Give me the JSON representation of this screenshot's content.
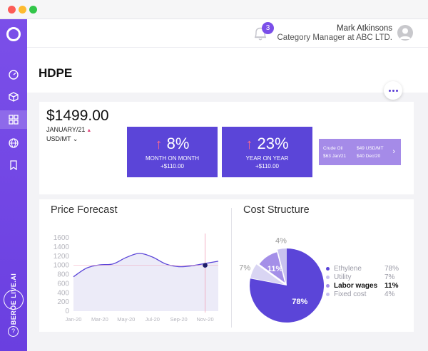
{
  "window": {
    "controls": [
      "close",
      "minimize",
      "maximize"
    ]
  },
  "sidebar": {
    "items": [
      {
        "name": "dashboard",
        "icon": "speedometer-icon",
        "active": false
      },
      {
        "name": "products",
        "icon": "cube-icon",
        "active": false
      },
      {
        "name": "grid",
        "icon": "grid-icon",
        "active": true
      },
      {
        "name": "global",
        "icon": "globe-icon",
        "active": false
      },
      {
        "name": "bookmarks",
        "icon": "bookmark-icon",
        "active": false
      }
    ],
    "brand": "BERÖE LIVE.AI",
    "help": "?"
  },
  "header": {
    "notifications_count": "3",
    "user_name": "Mark Atkinsons",
    "user_role": "Category Manager at ABC LTD."
  },
  "page": {
    "title": "HDPE"
  },
  "price": {
    "value": "$1499.00",
    "date": "JANUARY/21",
    "unit": "USD/MT",
    "unit_chevron": "⌄"
  },
  "kpis": {
    "mom": {
      "pct": "8%",
      "label": "MONTH ON MONTH",
      "delta": "+$110.00"
    },
    "yoy": {
      "pct": "23%",
      "label": "YEAR ON YEAR",
      "delta": "+$110.00"
    }
  },
  "crude_oil": {
    "name": "Crude Oil",
    "current": "$49 USD/MT",
    "low": "$63  Jan/21",
    "prev": "$40  Dec/20"
  },
  "forecast": {
    "title": "Price Forecast",
    "chart_data": {
      "type": "area",
      "x": [
        "Jan-20",
        "Feb-20",
        "Mar-20",
        "Apr-20",
        "May-20",
        "Jun-20",
        "Jul-20",
        "Aug-20",
        "Sep-20",
        "Oct-20",
        "Nov-20",
        "Dec-20"
      ],
      "x_tick_labels": [
        "Jan-20",
        "Mar-20",
        "May-20",
        "Jul-20",
        "Sep-20",
        "Nov-20"
      ],
      "values": [
        750,
        940,
        1010,
        1030,
        1170,
        1260,
        1180,
        1030,
        970,
        990,
        1040,
        1090
      ],
      "highlight": {
        "x": "Nov-20",
        "value": 1000
      },
      "ylim": [
        0,
        1600
      ],
      "y_ticks": [
        0,
        200,
        400,
        600,
        800,
        1000,
        1200,
        1400,
        1600
      ],
      "colors": {
        "line": "#5b45d8",
        "fill": "#ecebf8",
        "marker": "#1e1e6b",
        "guide": "#f0a0b8"
      }
    }
  },
  "cost": {
    "title": "Cost Structure",
    "chart_data": {
      "type": "pie",
      "slices": [
        {
          "label": "Ethylene",
          "value": 78,
          "display": "78%",
          "color": "#5b45d8"
        },
        {
          "label": "Utility",
          "value": 7,
          "display": "7%",
          "color": "#d9d5f3"
        },
        {
          "label": "Labor wages",
          "value": 11,
          "display": "11%",
          "color": "#a48fe8"
        },
        {
          "label": "Fixed cost",
          "value": 4,
          "display": "4%",
          "color": "#c9c2ef"
        }
      ]
    }
  }
}
